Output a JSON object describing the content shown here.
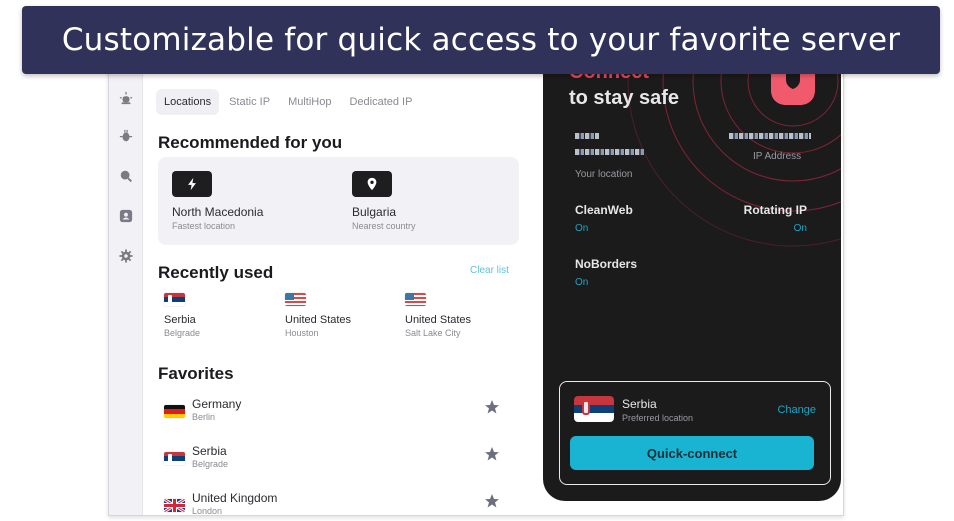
{
  "banner": {
    "caption": "Customizable for quick access to your favorite server"
  },
  "sidebar": {
    "items": [
      {
        "icon": "alert-siren-icon"
      },
      {
        "icon": "bug-icon"
      },
      {
        "icon": "search-icon"
      },
      {
        "icon": "account-icon"
      },
      {
        "icon": "gear-icon"
      }
    ]
  },
  "tabs": [
    {
      "label": "Locations",
      "active": true
    },
    {
      "label": "Static IP",
      "active": false
    },
    {
      "label": "MultiHop",
      "active": false
    },
    {
      "label": "Dedicated IP",
      "active": false
    }
  ],
  "recommended": {
    "title": "Recommended for you",
    "items": [
      {
        "icon": "lightning-icon",
        "name": "North Macedonia",
        "sub": "Fastest location"
      },
      {
        "icon": "location-pin-icon",
        "name": "Bulgaria",
        "sub": "Nearest country"
      }
    ]
  },
  "recent": {
    "title": "Recently used",
    "clear_label": "Clear list",
    "items": [
      {
        "flag": "serbia",
        "name": "Serbia",
        "city": "Belgrade"
      },
      {
        "flag": "usa",
        "name": "United States",
        "city": "Houston"
      },
      {
        "flag": "usa",
        "name": "United States",
        "city": "Salt Lake City"
      }
    ]
  },
  "favorites": {
    "title": "Favorites",
    "items": [
      {
        "flag": "germany",
        "name": "Germany",
        "city": "Berlin",
        "starred": true
      },
      {
        "flag": "serbia",
        "name": "Serbia",
        "city": "Belgrade",
        "starred": true
      },
      {
        "flag": "uk",
        "name": "United Kingdom",
        "city": "London",
        "starred": true
      }
    ]
  },
  "status_panel": {
    "title_accent": "Connect",
    "title_rest": "to stay safe",
    "location_label": "Your location",
    "ip_label": "IP Address",
    "features": [
      {
        "name": "CleanWeb",
        "value": "On"
      },
      {
        "name": "Rotating IP",
        "value": "On"
      },
      {
        "name": "NoBorders",
        "value": "On"
      }
    ],
    "preferred": {
      "country": "Serbia",
      "sub": "Preferred location",
      "change_label": "Change"
    },
    "quick_connect_label": "Quick-connect"
  },
  "colors": {
    "banner_bg": "#31325a",
    "accent_red": "#e8475e",
    "accent_cyan": "#18b4d2",
    "panel_bg": "#1b1b1c"
  }
}
